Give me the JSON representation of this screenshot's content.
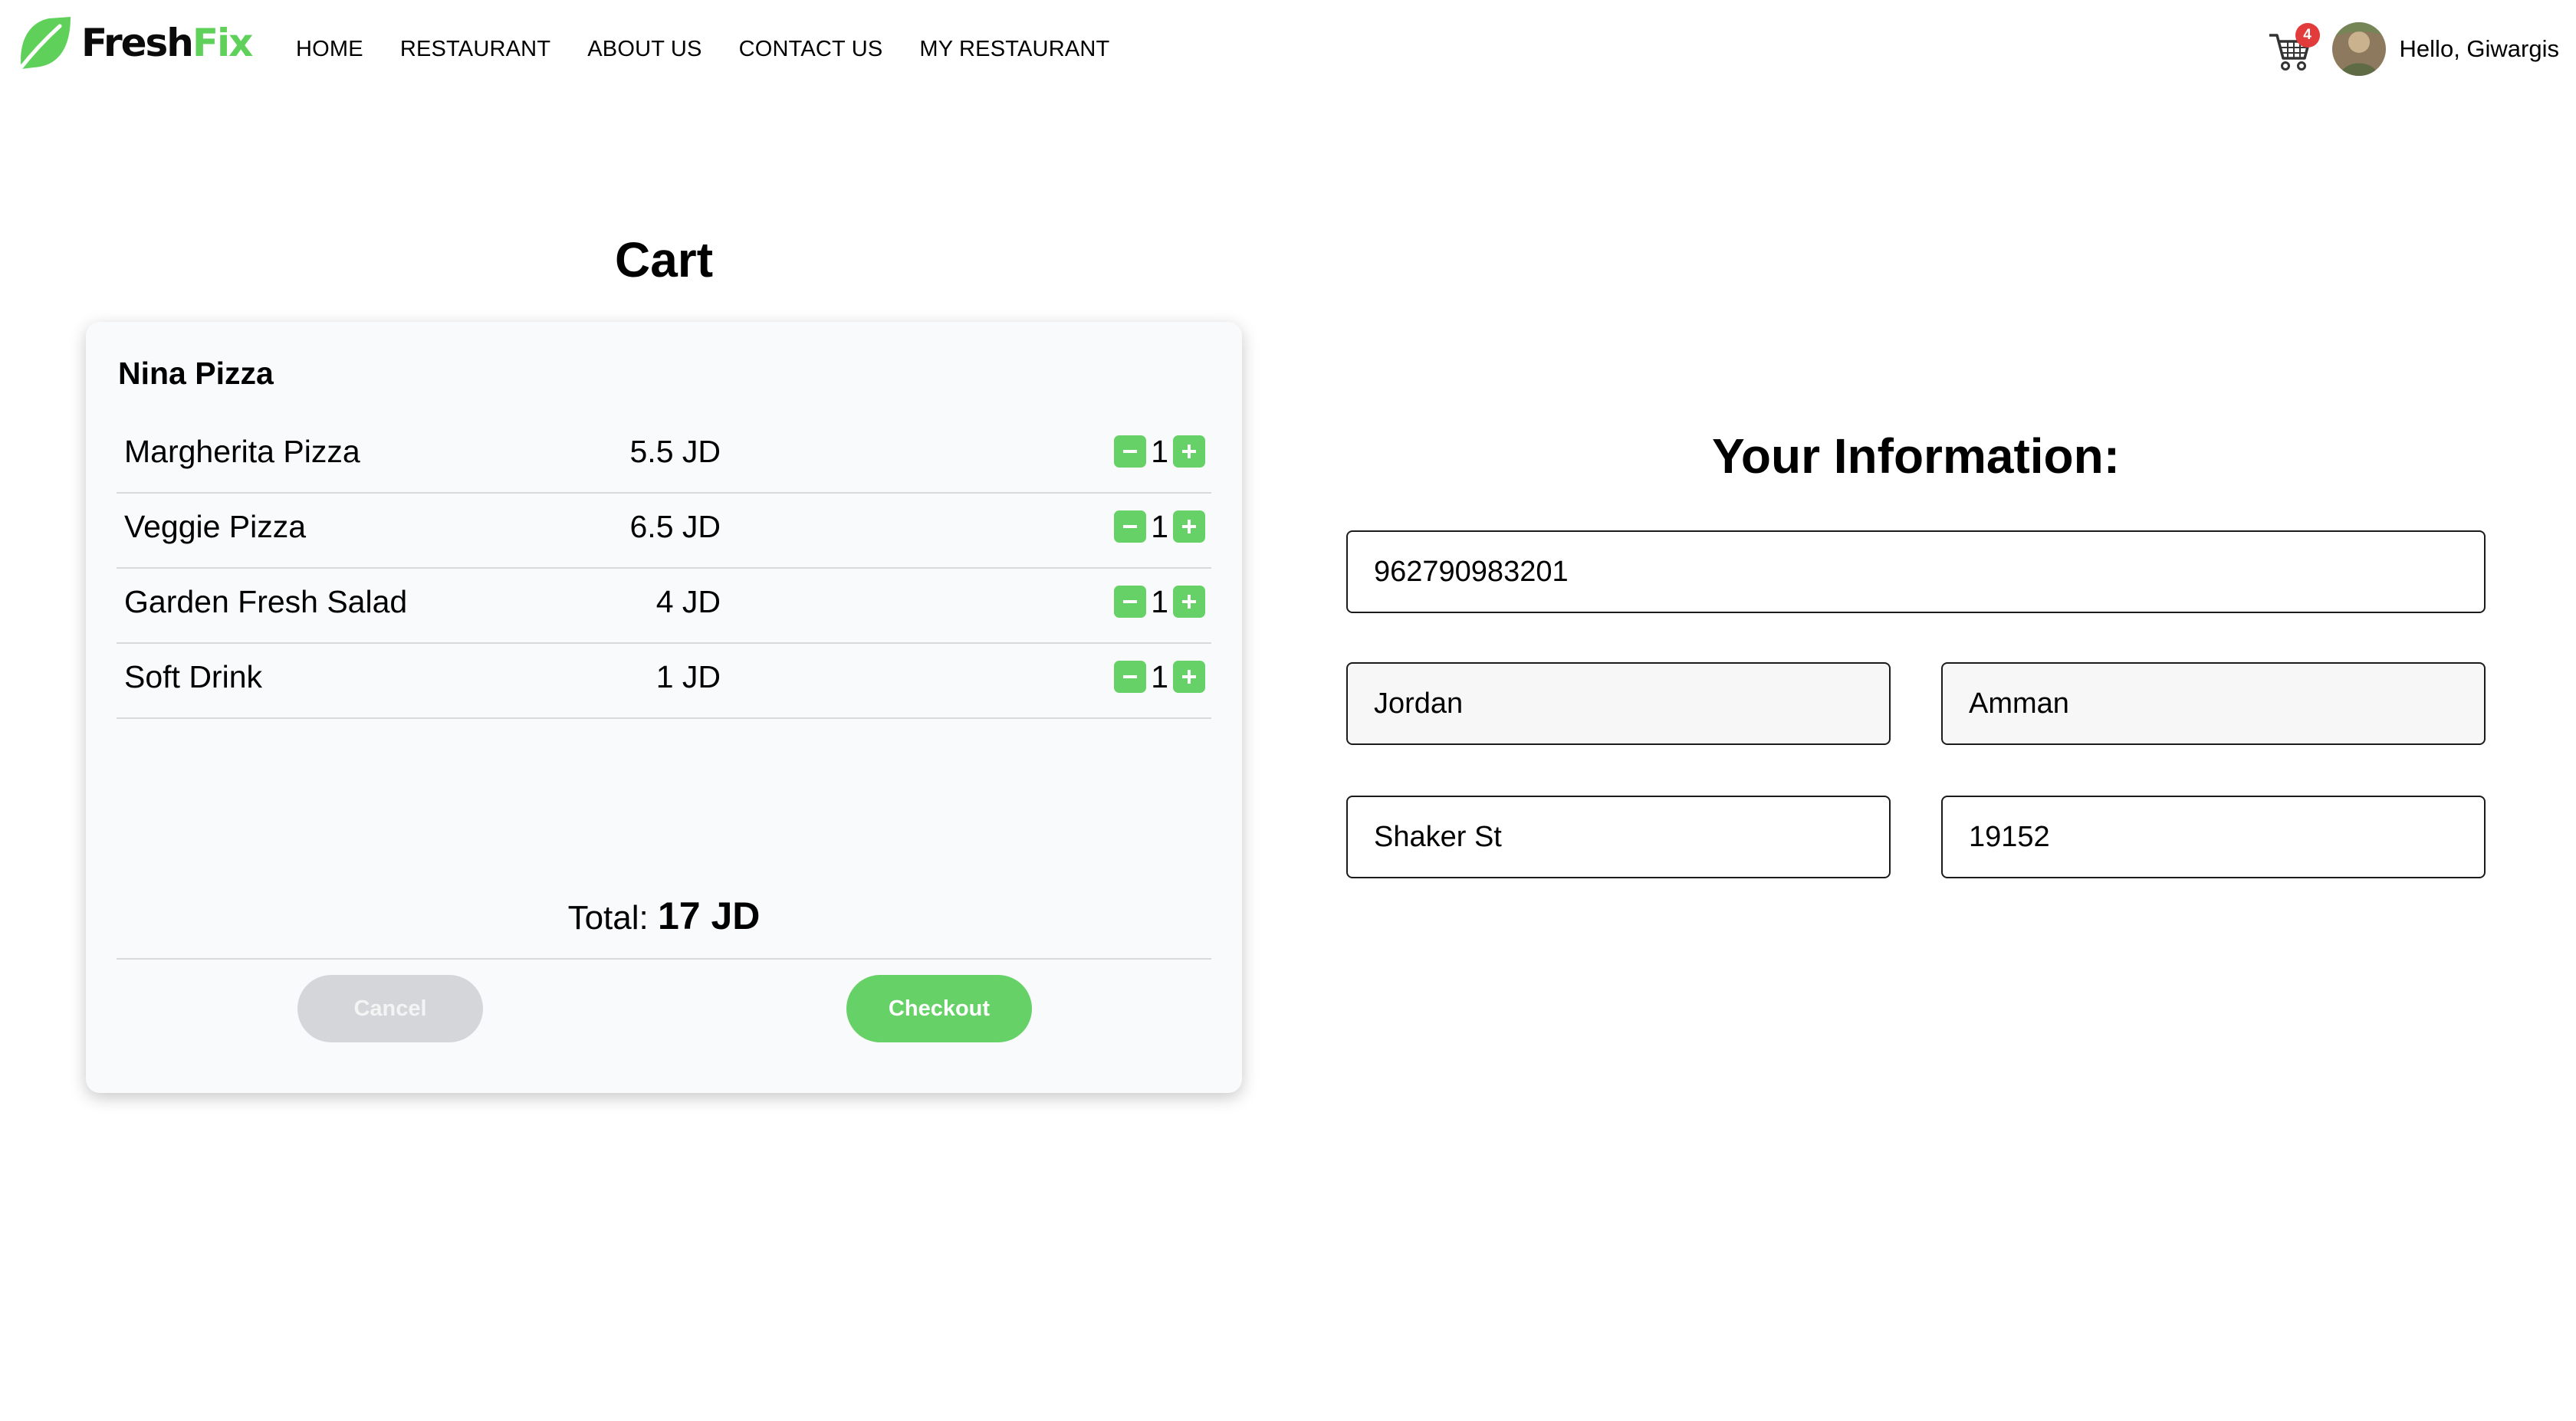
{
  "brand": {
    "logo_part1": "Fresh",
    "logo_part2": "Fix",
    "logo_icon": "leaf-icon",
    "accent_color": "#5fd15a"
  },
  "nav": {
    "items": [
      {
        "label": "HOME"
      },
      {
        "label": "RESTAURANT"
      },
      {
        "label": "ABOUT US"
      },
      {
        "label": "CONTACT US"
      },
      {
        "label": "MY RESTAURANT"
      }
    ]
  },
  "header": {
    "cart_icon": "shopping-cart-icon",
    "cart_count": "4",
    "greeting": "Hello, Giwargis"
  },
  "cart": {
    "title": "Cart",
    "restaurant_name": "Nina Pizza",
    "items": [
      {
        "name": "Margherita Pizza",
        "price": "5.5 JD",
        "qty": "1"
      },
      {
        "name": "Veggie Pizza",
        "price": "6.5 JD",
        "qty": "1"
      },
      {
        "name": "Garden Fresh Salad",
        "price": "4 JD",
        "qty": "1"
      },
      {
        "name": "Soft Drink",
        "price": "1 JD",
        "qty": "1"
      }
    ],
    "total_label": "Total: ",
    "total_value": "17 JD",
    "cancel_label": "Cancel",
    "checkout_label": "Checkout"
  },
  "info": {
    "title": "Your Information:",
    "phone": "962790983201",
    "country": "Jordan",
    "city": "Amman",
    "street": "Shaker St",
    "zip": "19152"
  }
}
